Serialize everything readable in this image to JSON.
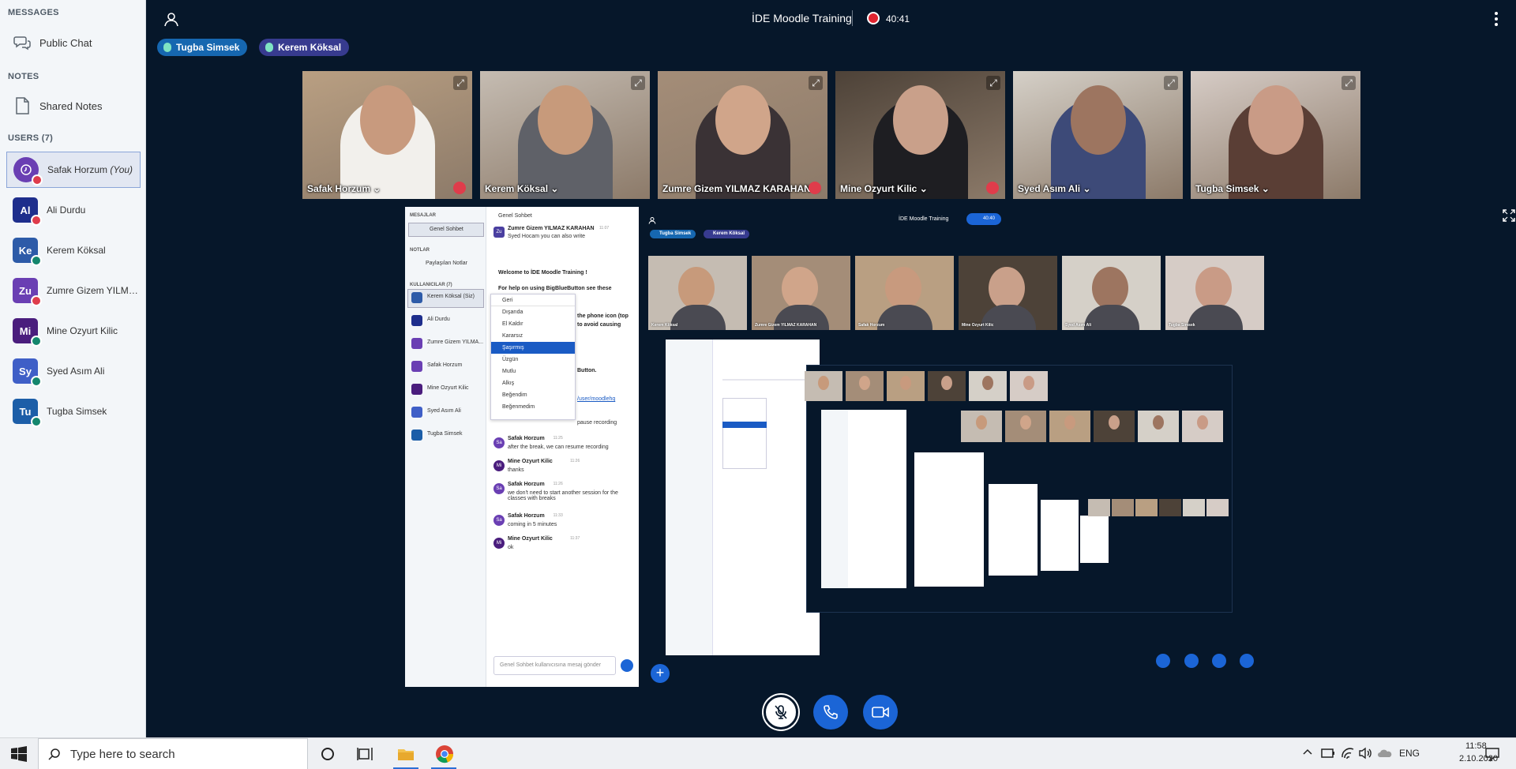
{
  "sidebar": {
    "messages_heading": "MESSAGES",
    "public_chat": "Public Chat",
    "notes_heading": "NOTES",
    "shared_notes": "Shared Notes",
    "users_heading": "USERS (7)",
    "users": [
      {
        "initials": "",
        "name": "Safak Horzum",
        "suffix": "(You)",
        "color": "#6a3fb3",
        "mic": "muted"
      },
      {
        "initials": "Al",
        "name": "Ali Durdu",
        "suffix": "",
        "color": "#1e2e8c",
        "mic": "muted"
      },
      {
        "initials": "Ke",
        "name": "Kerem Köksal",
        "suffix": "",
        "color": "#2d5ba8",
        "mic": "on"
      },
      {
        "initials": "Zu",
        "name": "Zumre Gizem YILMA...",
        "suffix": "",
        "color": "#6a3fb3",
        "mic": "muted"
      },
      {
        "initials": "Mi",
        "name": "Mine Ozyurt Kilic",
        "suffix": "",
        "color": "#4a1d7d",
        "mic": "on"
      },
      {
        "initials": "Sy",
        "name": "Syed Asım Ali",
        "suffix": "",
        "color": "#3f5fc7",
        "mic": "on"
      },
      {
        "initials": "Tu",
        "name": "Tugba Simsek",
        "suffix": "",
        "color": "#1c5ea8",
        "mic": "on"
      }
    ]
  },
  "topbar": {
    "title": "İDE Moodle Training",
    "recording_time": "40:41"
  },
  "talkers": [
    {
      "name": "Tugba Simsek",
      "color": "#1667b0"
    },
    {
      "name": "Kerem Köksal",
      "color": "#373b8f"
    }
  ],
  "videos": [
    {
      "name": "Safak Horzum",
      "muted": true,
      "bg": "#b99f82",
      "shirt": "#f2f0ec",
      "skin": "#c89a7e"
    },
    {
      "name": "Kerem Köksal",
      "muted": false,
      "bg": "#c5bcb2",
      "shirt": "#5f6168",
      "skin": "#c79a7b"
    },
    {
      "name": "Zumre Gizem YILMAZ KARAHAN",
      "muted": true,
      "bg": "#a48d78",
      "shirt": "#3a3235",
      "skin": "#d0a58a"
    },
    {
      "name": "Mine Ozyurt Kilic",
      "muted": true,
      "bg": "#4d4238",
      "shirt": "#1e1e22",
      "skin": "#c9a08a"
    },
    {
      "name": "Syed Asım Ali",
      "muted": false,
      "bg": "#d5d0c8",
      "shirt": "#3d4a78",
      "skin": "#9d7560"
    },
    {
      "name": "Tugba Simsek",
      "muted": false,
      "bg": "#d6ccc6",
      "shirt": "#5a3e35",
      "skin": "#c99b86"
    }
  ],
  "screenshare": {
    "side": {
      "messages": "MESAJLAR",
      "chat": "Genel Sohbet",
      "notes": "NOTLAR",
      "shared_notes": "Paylaşılan Notlar",
      "users": "KULLANICILAR (7)",
      "user_list": [
        "Kerem Köksal (Siz)",
        "Ali Durdu",
        "Zumre Gizem YILMA...",
        "Safak Horzum",
        "Mine Ozyurt Kilic",
        "Syed Asım Ali",
        "Tugba Simsek"
      ]
    },
    "chat_header": "Genel Sohbet",
    "first_msg_name": "Zumre Gizem YILMAZ KARAHAN",
    "first_msg_time": "11:07",
    "first_msg_text": "Syed Hocam you can also write",
    "welcome": "Welcome to İDE Moodle Training !",
    "help": "For help on using BigBlueButton see these",
    "fragment1": "the phone icon (top",
    "fragment2": "to avoid causing",
    "fragment3": "Button.",
    "fragment4": "/user/moodlehq",
    "fragment5": "pause recording",
    "menu": [
      "Geri",
      "Dışarıda",
      "El Kaldır",
      "Kararsız",
      "Şaşırmış",
      "Üzgün",
      "Mutlu",
      "Alkış",
      "Beğendim",
      "Beğenmedim"
    ],
    "messages": [
      {
        "initials": "Sa",
        "name": "Safak Horzum",
        "time": "11:25",
        "text": "after the break, we can resume recording"
      },
      {
        "initials": "Mi",
        "name": "Mine Ozyurt Kilic",
        "time": "11:26",
        "text": "thanks"
      },
      {
        "initials": "Sa",
        "name": "Safak Horzum",
        "time": "11:26",
        "text": "we don't need to start another session for the classes with breaks"
      },
      {
        "initials": "Sa",
        "name": "Safak Horzum",
        "time": "11:33",
        "text": "coming in 5 minutes"
      },
      {
        "initials": "Mi",
        "name": "Mine Ozyurt Kilic",
        "time": "11:37",
        "text": "ok"
      }
    ],
    "input_placeholder": "Genel Sohbet kullanıcısına mesaj gönder",
    "nested_title": "İDE Moodle Training",
    "nested_time": "40:40",
    "nested_talkers": [
      "Tugba Simsek",
      "Kerem Köksal"
    ],
    "nested_videos": [
      "Kerem Köksal",
      "Zumre Gizem YILMAZ KARAHAN",
      "Safak Horzum",
      "Mine Ozyurt Kilic",
      "Syed Asım Ali",
      "Tugba Simsek"
    ]
  },
  "taskbar": {
    "search_placeholder": "Type here to search",
    "lang": "ENG",
    "time": "11:58",
    "date": "2.10.2020"
  },
  "colors": {
    "accent": "#1b65d6",
    "background": "#06172a",
    "recording": "#e0242f"
  }
}
